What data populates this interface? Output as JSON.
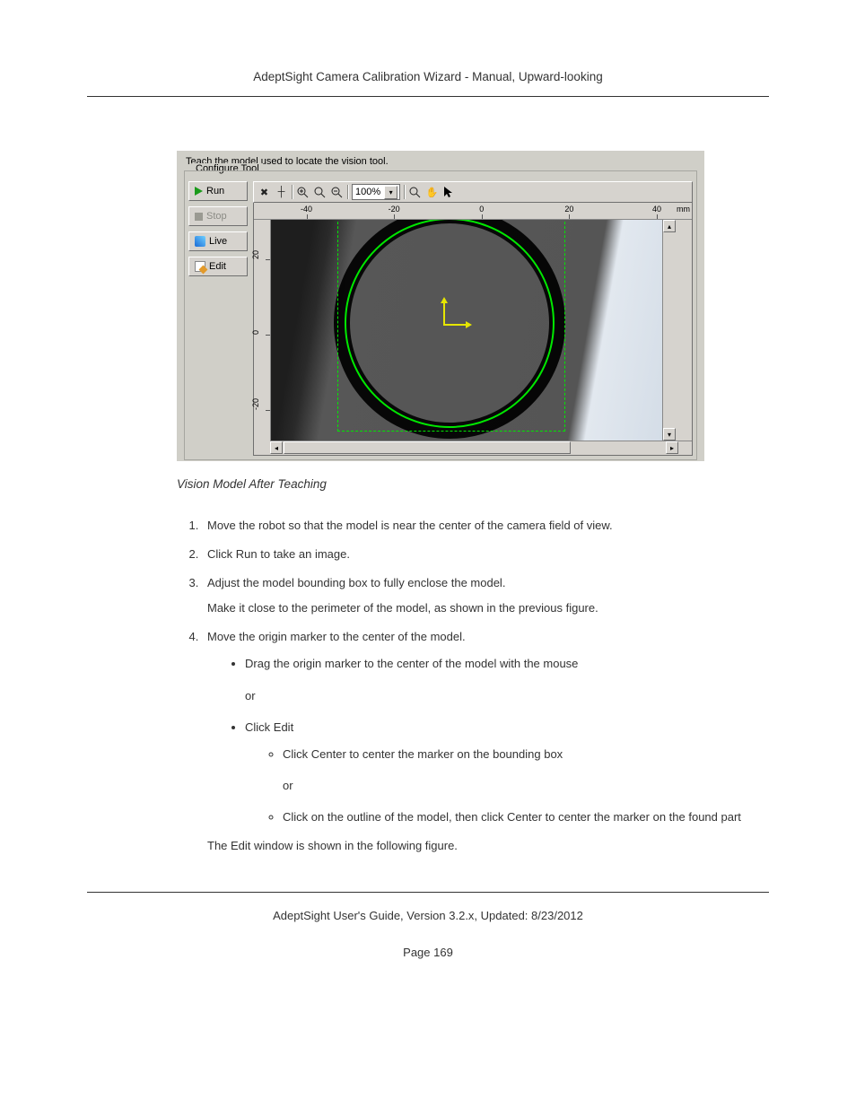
{
  "header": {
    "title": "AdeptSight Camera Calibration Wizard - Manual, Upward-looking"
  },
  "screenshot": {
    "instruction": "Teach the model used to locate the vision tool.",
    "group_legend": "Configure Tool",
    "buttons": {
      "run": "Run",
      "stop": "Stop",
      "live": "Live",
      "edit": "Edit"
    },
    "zoom_value": "100%",
    "ruler_x": {
      "labels": [
        "-40",
        "-20",
        "0",
        "20",
        "40"
      ],
      "unit": "mm"
    },
    "ruler_y": {
      "labels": [
        "20",
        "0",
        "-20"
      ]
    }
  },
  "caption": "Vision Model After Teaching",
  "steps": {
    "s1": "Move the robot so that the model is near the center of the camera field of view.",
    "s2": "Click Run to take an image.",
    "s3": "Adjust the model bounding box to fully enclose the model.",
    "s3b": "Make it close to the perimeter of the model, as shown in the previous figure.",
    "s4": "Move the origin marker to the center of the model.",
    "s4_b1": "Drag the origin marker to the center of the model with the mouse",
    "s4_or": "or",
    "s4_b2": "Click Edit",
    "s4_b2_c1": "Click Center to center the marker on the bounding box",
    "s4_b2_or": "or",
    "s4_b2_c2": "Click on the outline of the model, then click Center to center the marker on the found part",
    "s4_tail": "The Edit window is shown in the following figure."
  },
  "footer": {
    "line": "AdeptSight User's Guide,  Version 3.2.x, Updated: 8/23/2012",
    "page": "Page 169"
  }
}
